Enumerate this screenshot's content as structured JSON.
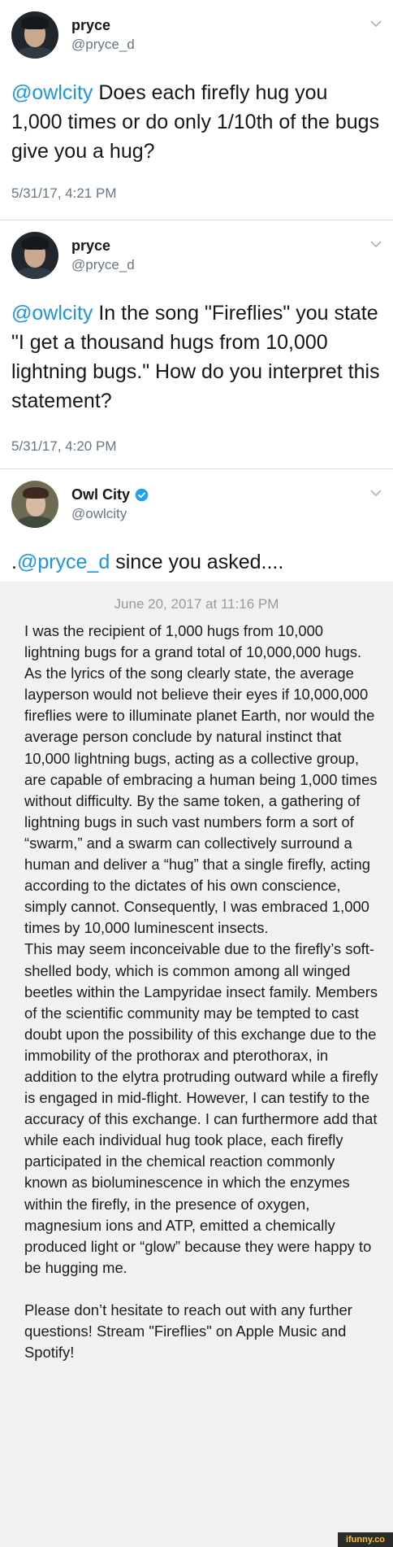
{
  "tweets": [
    {
      "display_name": "pryce",
      "handle": "@pryce_d",
      "mention": "@owlcity",
      "text": " Does each firefly hug you 1,000 times or do only 1/10th of the bugs give you a hug?",
      "timestamp": "5/31/17, 4:21 PM",
      "avatar_icon": "user-photo"
    },
    {
      "display_name": "pryce",
      "handle": "@pryce_d",
      "mention": "@owlcity",
      "text": " In the song \"Fireflies\" you state \"I get a thousand hugs from 10,000 lightning bugs.\" How do you interpret this statement?",
      "timestamp": "5/31/17, 4:20 PM",
      "avatar_icon": "user-photo"
    },
    {
      "display_name": "Owl City",
      "verified": true,
      "handle": "@owlcity",
      "prefix": ".",
      "mention": "@pryce_d",
      "text": " since you asked....",
      "avatar_icon": "user-photo"
    }
  ],
  "note": {
    "date": "June 20, 2017 at 11:16 PM",
    "paragraphs": [
      "I was the recipient of 1,000 hugs from 10,000 lightning bugs for a grand total of 10,000,000 hugs. As the lyrics of the song clearly state, the average layperson would not believe their eyes if 10,000,000 fireflies were to illuminate planet Earth, nor would the average person conclude by natural instinct that 10,000 lightning bugs, acting as a collective group, are capable of embracing a human being 1,000 times without difficulty. By the same token, a gathering of lightning bugs in such vast numbers form a sort of “swarm,” and a swarm can collectively surround a human and deliver a “hug” that a single firefly, acting according to the dictates of his own conscience, simply cannot. Consequently, I was embraced 1,000 times by 10,000 luminescent insects.",
      "This may seem inconceivable due to the firefly’s soft-shelled body, which is common among all winged beetles within the Lampyridae insect family. Members of the scientific community may be tempted to cast doubt upon the possibility of this exchange due to the immobility of the prothorax and pterothorax, in addition to the elytra protruding outward while a firefly is engaged in mid-flight. However, I can testify to the accuracy of this exchange. I can furthermore add that while each individual hug took place, each firefly participated in the chemical reaction commonly known as bioluminescence in which the enzymes within the firefly, in the presence of oxygen, magnesium ions and ATP, emitted a chemically produced light or “glow” because they were happy to be hugging me.",
      "Please don’t hesitate to reach out with any further questions! Stream \"Fireflies\" on Apple Music and Spotify!"
    ]
  },
  "watermark": "ifunny.co",
  "colors": {
    "link": "#1b95e0",
    "muted": "#657786",
    "note_bg": "#f1f1ef"
  }
}
